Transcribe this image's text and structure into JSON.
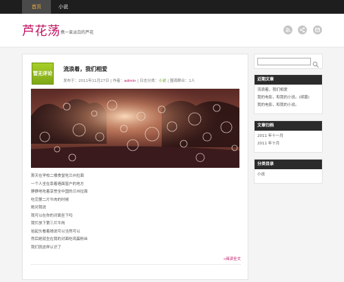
{
  "nav": {
    "items": [
      "首页",
      "小说"
    ],
    "active_index": 0
  },
  "header": {
    "title": "芦花荡",
    "description": "携一束淡白的芦花"
  },
  "social_icons": [
    "rss-icon",
    "share-icon",
    "feed-icon"
  ],
  "post": {
    "badge": "暂无评论",
    "title": "流浪着，我们相爱",
    "meta": {
      "published_prefix": "发布于：",
      "date": "2011年11月27日",
      "author_prefix": "作者：",
      "author": "admin",
      "category_prefix": "日志分类：",
      "category": "小说",
      "views": "围观群众：1人",
      "separator": " | "
    },
    "lines": [
      "那天在学校二楼食堂吃兰州拉面",
      "一个人坐在靠着墙面窗户的地方",
      "静静地吃着享誉全中国的兰州拉面",
      "吃完第二片牛肉的时候",
      "她对我说",
      "我可以在你的对面坐下吗",
      "我忙放下第三片牛肉",
      "抬起头看着她说可以当然可以",
      "然后她就坐在我的对面吃鸡蛋粉丝",
      "我们就这样认识了"
    ],
    "read_more": "»阅读全文"
  },
  "sidebar": {
    "recent": {
      "title": "近期文章",
      "items": [
        "流浪着，我们相爱",
        "我的电影，和我的小说。(续篇)",
        "我的电影，和我的小说。"
      ]
    },
    "archives": {
      "title": "文章归档",
      "items": [
        "2011 年十一月",
        "2011 年十月"
      ]
    },
    "categories": {
      "title": "分类目录",
      "items": [
        "小说"
      ]
    }
  }
}
